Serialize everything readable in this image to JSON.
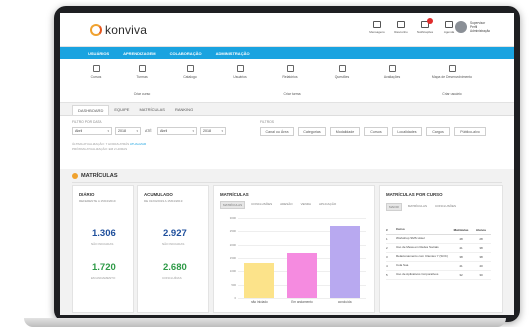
{
  "brand": {
    "name": "konviva"
  },
  "toolbar": [
    {
      "icon": "mail-icon",
      "label": "Mensagens"
    },
    {
      "icon": "pencil-icon",
      "label": "Rascunho"
    },
    {
      "icon": "bell-icon",
      "label": "Notificações"
    },
    {
      "icon": "calendar-icon",
      "label": "Agenda"
    }
  ],
  "user": {
    "name": "Supervisor",
    "role": "Perfil",
    "profile": "Administração"
  },
  "nav": [
    "USUÁRIOS",
    "APRENDIZAGEM",
    "COLABORAÇÃO",
    "ADMINISTRAÇÃO"
  ],
  "shortcuts": {
    "row1": [
      {
        "icon": "course-icon",
        "label": "Cursos"
      },
      {
        "icon": "class-icon",
        "label": "Turmas"
      },
      {
        "icon": "catalog-icon",
        "label": "Catalogo"
      },
      {
        "icon": "users-icon",
        "label": "Usuários"
      },
      {
        "icon": "reports-icon",
        "label": "Relatórios"
      },
      {
        "icon": "questions-icon",
        "label": "Questões"
      },
      {
        "icon": "assessment-icon",
        "label": "Avaliações"
      },
      {
        "icon": "map-pin-icon",
        "label": "Mapa de Desenvolvimento"
      }
    ],
    "row2": [
      "Criar curso",
      "Criar turma",
      "Criar usuário"
    ]
  },
  "tabs": [
    "DASHBOARD",
    "EQUIPE",
    "MATRÍCULAS",
    "RANKING"
  ],
  "filters": {
    "date_label": "FILTRO POR DATA",
    "from_month": "Abril",
    "from_year": "2018",
    "until": "ATÉ",
    "to_month": "Abril",
    "to_year": "2018",
    "note_line1": "ÚLTIMA ATUALIZAÇÃO: 7 HORAS ATRÁS",
    "note_action": "ATUALIZAR",
    "note_line2": "PRÓXIMA ATUALIZAÇÃO: EM 2 HORAS",
    "group_label": "FILTROS",
    "buttons": [
      "Canal ou Área",
      "Categorias",
      "Modalidade",
      "Cursos",
      "Localidades",
      "Cargos",
      "Público-alvo"
    ]
  },
  "section": {
    "title": "MATRÍCULAS"
  },
  "diario": {
    "title": "DIÁRIO",
    "subtitle": "REFERENTE A 15/04/2019",
    "kpi1": "1.306",
    "kpi1_label": "NÃO INICIADAS",
    "kpi2": "1.720",
    "kpi2_label": "EM ANDAMENTO"
  },
  "acumulado": {
    "title": "ACUMULADO",
    "subtitle": "DE 01/04/2019 A 15/04/2019",
    "kpi1": "2.927",
    "kpi1_label": "NÃO INICIADAS",
    "kpi2": "2.680",
    "kpi2_label": "CONCLUÍDAS"
  },
  "matriculas_chart": {
    "title": "MATRÍCULAS",
    "tabs": [
      "MATRÍCULAS",
      "CONCLUSÕES",
      "ADESÃO",
      "VENDA",
      "APLICAÇÃO"
    ]
  },
  "chart_data": {
    "type": "bar",
    "title": "MATRÍCULAS",
    "categories": [
      "não iniciado",
      "Em andamento",
      "concluída"
    ],
    "values": [
      1300,
      1700,
      2700
    ],
    "ylim": [
      0,
      3000
    ],
    "yticks": [
      "3000",
      "2500",
      "2000",
      "1500",
      "1000",
      "500",
      "0"
    ],
    "colors": [
      "#fce38a",
      "#f58be0",
      "#b8a9f0"
    ],
    "grid": true
  },
  "por_curso": {
    "title": "MATRÍCULAS POR CURSO",
    "tabs": [
      "MAIOR",
      "MATRÍCULAS",
      "CONCLUSÕES"
    ],
    "headers": [
      "#",
      "Curso",
      "Matrículas",
      "Alunos"
    ],
    "rows": [
      [
        "1",
        "Workshop SMS Hotel",
        "48",
        "28"
      ],
      [
        "2",
        "Uso de Mesa em Redes Sociais",
        "41",
        "38"
      ],
      [
        "3",
        "Relacionamento com Clientes Y (SOC)",
        "38",
        "38"
      ],
      [
        "4",
        "Cola Sua",
        "41",
        "40"
      ],
      [
        "5",
        "Uso de Aplicativos Corporativos",
        "32",
        "30"
      ]
    ]
  }
}
